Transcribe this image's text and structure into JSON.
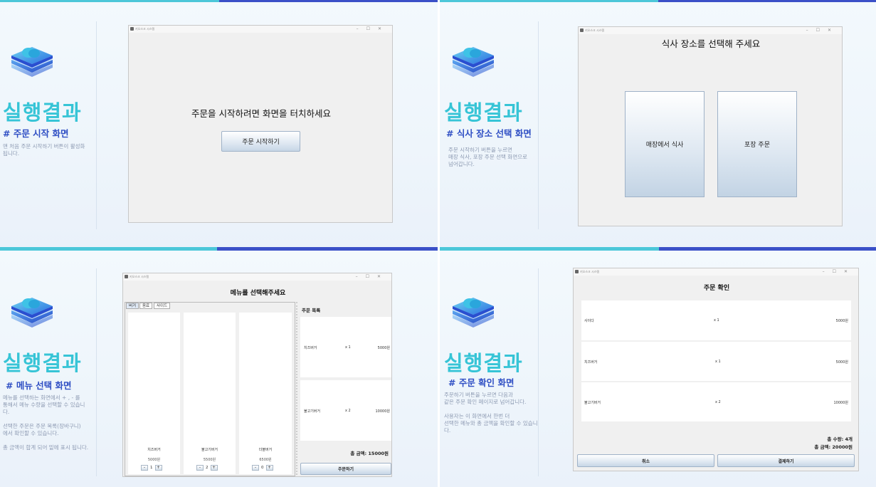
{
  "colors": {
    "cyan": "#36c4d6",
    "blue": "#2f4fc4",
    "cyan_bar": "#4cc7d9",
    "blue_bar": "#3b50c8"
  },
  "icons": {
    "logo": "stacked-layers-cloud-icon"
  },
  "window_title": "키오스크 시스템",
  "window_controls": "–☐✕",
  "panels": [
    {
      "result_title": "실행결과",
      "sub_title": "# 주문 시작 화면",
      "desc": "맨 처음 주문 시작하기 버튼이 활성화\n됩니다.",
      "screen": {
        "prompt": "주문을 시작하려면 화면을 터치하세요",
        "button": "주문 시작하기"
      }
    },
    {
      "result_title": "실행결과",
      "sub_title": "# 식사 장소 선택 화면",
      "desc": "주문 시작하기 버튼을 누르면\n매장 식사, 포장 주문 선택 화면으로\n넘어갑니다.",
      "screen": {
        "title": "식사 장소를 선택해 주세요",
        "options": [
          "매장에서 식사",
          "포장 주문"
        ]
      }
    },
    {
      "result_title": "실행결과",
      "sub_title": "# 메뉴 선택 화면",
      "desc": "메뉴를 선택하는 화면에서 + , - 를\n통해서 메뉴 수량을 선택할 수 있습니\n다.\n\n선택한 주문은 주문 목록(장바구니)\n에서 확인할 수 있습니다.\n\n총 금액이 합계 되어 밑에 표시 됩니다.",
      "screen": {
        "title": "메뉴를 선택해주세요",
        "tabs": [
          "버거",
          "음료",
          "사이드"
        ],
        "menu_items": [
          {
            "name": "치즈버거",
            "price": "5000원",
            "qty": "1"
          },
          {
            "name": "불고기버거",
            "price": "5500원",
            "qty": "2"
          },
          {
            "name": "더블버거",
            "price": "6500원",
            "qty": "0"
          }
        ],
        "stepper_minus": "-",
        "stepper_plus": "+",
        "order_list_title": "주문 목록",
        "order_list": [
          {
            "name": "치즈버거",
            "qty": "x 1",
            "price": "5000원"
          },
          {
            "name": "불고기버거",
            "qty": "x 2",
            "price": "10000원"
          }
        ],
        "total": "총 금액: 15000원",
        "order_button": "주문하기"
      }
    },
    {
      "result_title": "실행결과",
      "sub_title": "# 주문 확인 화면",
      "desc": "주문하기 버튼을 누르면 다음과\n같은 주문 확인 페이지로 넘어갑니다.\n\n사용자는 이 화면에서 한번 더\n선택한 메뉴와 총 금액을 확인할 수 있습니\n다.",
      "screen": {
        "title": "주문 확인",
        "items": [
          {
            "name": "사이다",
            "qty": "x 1",
            "price": "5000원"
          },
          {
            "name": "치즈버거",
            "qty": "x 1",
            "price": "5000원"
          },
          {
            "name": "불고기버거",
            "qty": "x 2",
            "price": "10000원"
          }
        ],
        "total_qty": "총 수량: 4개",
        "total_amount": "총 금액: 20000원",
        "cancel_button": "취소",
        "pay_button": "결제하기"
      }
    }
  ]
}
